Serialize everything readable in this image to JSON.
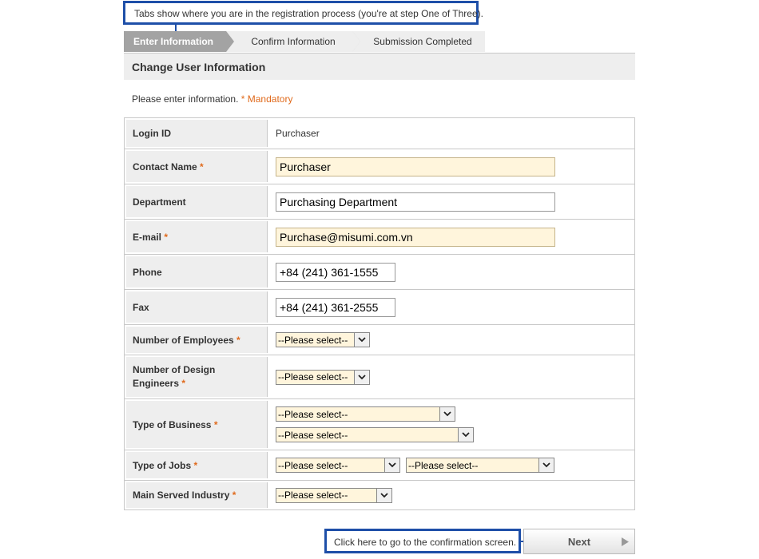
{
  "annotations": {
    "tabs_note": "Tabs show where you are in the registration process (you're at step One of Three).",
    "next_note": "Click here to go to the confirmation screen."
  },
  "steps": [
    {
      "label": "Enter Information",
      "active": true
    },
    {
      "label": "Confirm Information",
      "active": false
    },
    {
      "label": "Submission Completed",
      "active": false
    }
  ],
  "section": {
    "title": "Change User Information",
    "intro": "Please enter information.",
    "mandatory_note": "* Mandatory"
  },
  "required_mark": "*",
  "fields": {
    "login_id": {
      "label": "Login ID",
      "value": "Purchaser"
    },
    "contact_name": {
      "label": "Contact Name",
      "value": "Purchaser"
    },
    "department": {
      "label": "Department",
      "value": "Purchasing Department"
    },
    "email": {
      "label": "E-mail",
      "value": "Purchase@misumi.com.vn"
    },
    "phone": {
      "label": "Phone",
      "value": "+84 (241) 361-1555"
    },
    "fax": {
      "label": "Fax",
      "value": "+84 (241) 361-2555"
    },
    "num_employees": {
      "label": "Number of Employees",
      "value": "--Please select--"
    },
    "num_design_engineers": {
      "label_line1": "Number of Design",
      "label_line2": "Engineers",
      "value": "--Please select--"
    },
    "type_of_business": {
      "label": "Type of Business",
      "value1": "--Please select--",
      "value2": "--Please select--"
    },
    "type_of_jobs": {
      "label": "Type of Jobs",
      "value1": "--Please select--",
      "value2": "--Please select--"
    },
    "main_served_industry": {
      "label": "Main Served Industry",
      "value": "--Please select--"
    }
  },
  "buttons": {
    "next": "Next"
  },
  "colors": {
    "callout_border": "#1e4fa8",
    "required_accent": "#e06a1c",
    "required_field_bg": "#fff5dc"
  }
}
